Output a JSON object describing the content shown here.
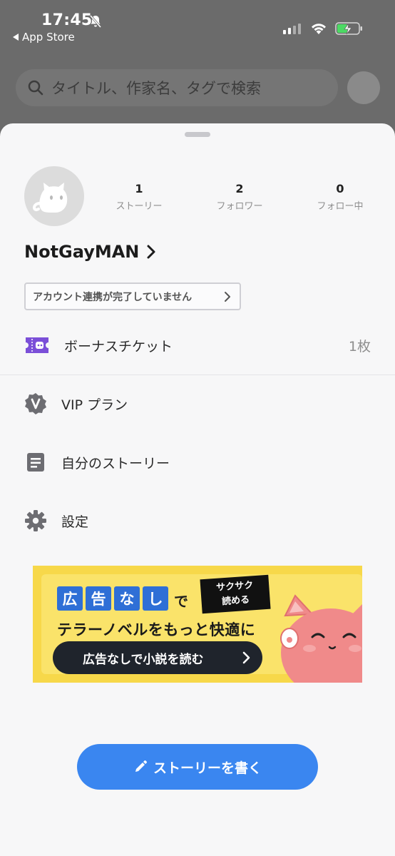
{
  "status_bar": {
    "time": "17:45",
    "back_app": "App Store"
  },
  "search": {
    "placeholder": "タイトル、作家名、タグで検索"
  },
  "profile": {
    "username": "NotGayMAN",
    "stats": [
      {
        "value": "1",
        "label": "ストーリー"
      },
      {
        "value": "2",
        "label": "フォロワー"
      },
      {
        "value": "0",
        "label": "フォロー中"
      }
    ],
    "link_notice": "アカウント連携が完了していません"
  },
  "menu": {
    "bonus_ticket": {
      "label": "ボーナスチケット",
      "count": "1枚"
    },
    "vip": {
      "label": "VIP プラン",
      "icon": "vip-badge-icon"
    },
    "my_stories": {
      "label": "自分のストーリー",
      "icon": "document-icon"
    },
    "settings": {
      "label": "設定",
      "icon": "gear-icon"
    }
  },
  "banner": {
    "chars": [
      "広",
      "告",
      "な",
      "し"
    ],
    "de": "で",
    "tag_line1": "サクサク",
    "tag_line2": "読める",
    "headline": "テラーノベルをもっと快適に",
    "cta": "広告なしで小説を読む"
  },
  "write_button": {
    "label": "ストーリーを書く",
    "color": "#3a86f0"
  },
  "colors": {
    "accent": "#3a86f0",
    "ticket": "#7b4fd8",
    "banner_bg": "#f7d84a",
    "banner_blue": "#2f6fd6"
  }
}
